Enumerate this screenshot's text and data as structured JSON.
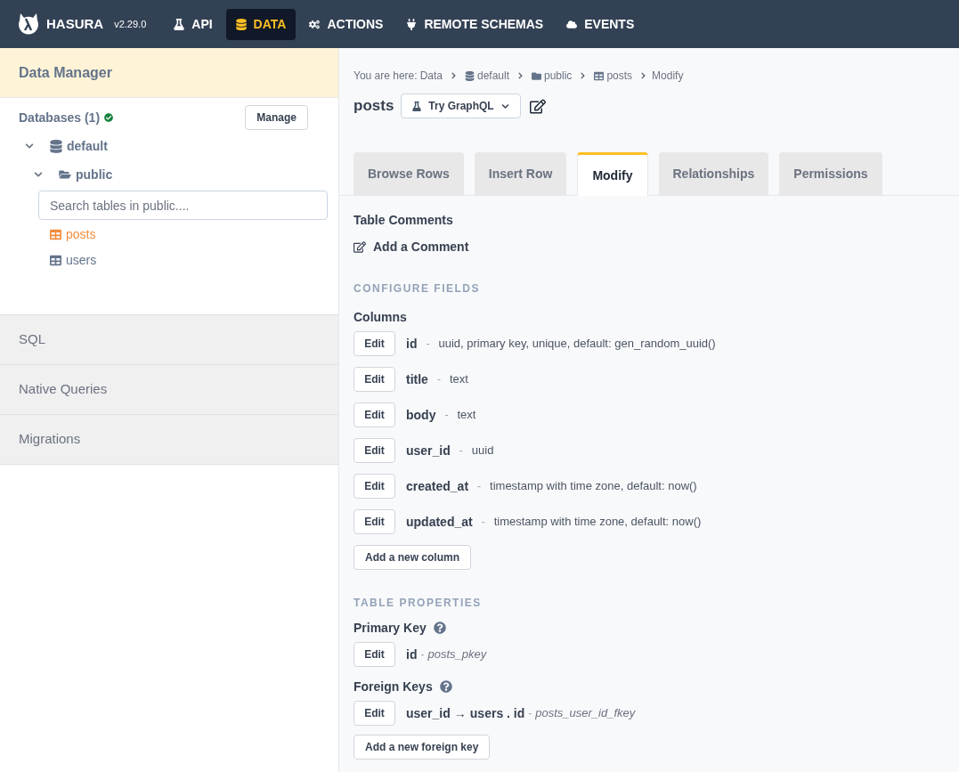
{
  "topbar": {
    "brand": "HASURA",
    "version": "v2.29.0",
    "nav": [
      {
        "label": "API",
        "kind": "flask",
        "selected": false
      },
      {
        "label": "DATA",
        "kind": "database",
        "selected": true
      },
      {
        "label": "ACTIONS",
        "kind": "cogs",
        "selected": false
      },
      {
        "label": "REMOTE SCHEMAS",
        "kind": "plug",
        "selected": false
      },
      {
        "label": "EVENTS",
        "kind": "cloud",
        "selected": false
      }
    ]
  },
  "sidebar": {
    "title": "Data Manager",
    "databases_label": "Databases (1)",
    "healthy": true,
    "manage_button": "Manage",
    "tree": [
      {
        "label": "default",
        "kind": "database",
        "expanded": true,
        "children": [
          {
            "label": "public",
            "kind": "schema",
            "expanded": true,
            "search": {
              "placeholder": "Search tables in public...."
            },
            "children": [
              {
                "label": "posts",
                "kind": "table",
                "selected": true
              },
              {
                "label": "users",
                "kind": "table",
                "selected": false
              }
            ]
          }
        ]
      }
    ],
    "sections": [
      "SQL",
      "Native Queries",
      "Migrations"
    ]
  },
  "breadcrumb": {
    "prefix": "You are here:",
    "items": [
      {
        "label": "Data",
        "kind": "root"
      },
      {
        "label": "default",
        "kind": "database"
      },
      {
        "label": "public",
        "kind": "folder"
      },
      {
        "label": "posts",
        "kind": "table"
      },
      {
        "label": "Modify",
        "kind": "page"
      }
    ]
  },
  "header": {
    "title": "posts",
    "graphql_button": "Try GraphQL"
  },
  "tabs": [
    {
      "label": "Browse Rows",
      "selected": false
    },
    {
      "label": "Insert Row",
      "selected": false
    },
    {
      "label": "Modify",
      "selected": true
    },
    {
      "label": "Relationships",
      "selected": false
    },
    {
      "label": "Permissions",
      "selected": false
    }
  ],
  "table_comments": {
    "heading": "Table Comments",
    "add_link": "Add a Comment"
  },
  "configure_fields": {
    "heading": "CONFIGURE FIELDS",
    "columns_heading": "Columns",
    "columns": [
      {
        "edit": "Edit",
        "name": "id",
        "separator": "-",
        "type": "uuid, primary key, unique, default: gen_random_uuid()"
      },
      {
        "edit": "Edit",
        "name": "title",
        "separator": "-",
        "type": "text"
      },
      {
        "edit": "Edit",
        "name": "body",
        "separator": "-",
        "type": "text"
      },
      {
        "edit": "Edit",
        "name": "user_id",
        "separator": "-",
        "type": "uuid"
      },
      {
        "edit": "Edit",
        "name": "created_at",
        "separator": "-",
        "type": "timestamp with time zone, default: now()"
      },
      {
        "edit": "Edit",
        "name": "updated_at",
        "separator": "-",
        "type": "timestamp with time zone, default: now()"
      }
    ],
    "add_button": "Add a new column"
  },
  "table_properties": {
    "heading": "TABLE PROPERTIES",
    "primary_key": {
      "heading": "Primary Key",
      "edit": "Edit",
      "column": "id",
      "separator": "-",
      "constraint": "posts_pkey"
    },
    "foreign_keys": {
      "heading": "Foreign Keys",
      "items": [
        {
          "edit": "Edit",
          "from": "user_id",
          "arrow": "→",
          "to": "users . id",
          "separator": "-",
          "constraint": "posts_user_id_fkey"
        }
      ],
      "add_button": "Add a new foreign key"
    }
  }
}
